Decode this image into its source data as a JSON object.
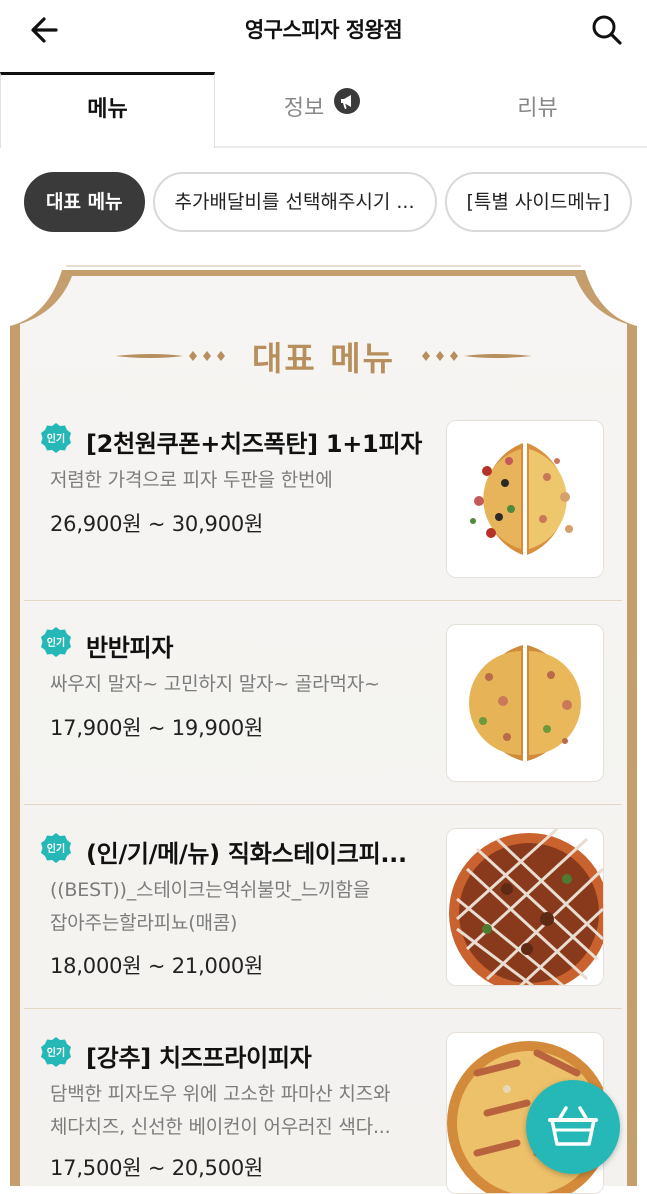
{
  "header": {
    "title": "영구스피자 정왕점"
  },
  "tabs": [
    {
      "label": "메뉴",
      "active": true
    },
    {
      "label": "정보",
      "active": false
    },
    {
      "label": "리뷰",
      "active": false
    }
  ],
  "chips": [
    {
      "label": "대표 메뉴",
      "active": true
    },
    {
      "label": "추가배달비를 선택해주시기 ...",
      "active": false
    },
    {
      "label": "[특별 사이드메뉴]",
      "active": false
    }
  ],
  "section": {
    "title": "대표 메뉴"
  },
  "badge_label": "인기",
  "menu_items": [
    {
      "name": "[2천원쿠폰+치즈폭탄] 1+1피자",
      "desc": "저렴한 가격으로 피자 두판을 한번에",
      "price": "26,900원 ~ 30,900원"
    },
    {
      "name": "반반피자",
      "desc": "싸우지 말자~ 고민하지 말자~ 골라먹자~",
      "price": "17,900원 ~ 19,900원"
    },
    {
      "name": "(인/기/메/뉴) 직화스테이크피...",
      "desc_line1": "((BEST))_스테이크는역쉬불맛_느끼함을",
      "desc_line2": "잡아주는할라피뇨(매콤)",
      "price": "18,000원 ~ 21,000원"
    },
    {
      "name": "[강추] 치즈프라이피자",
      "desc_line1": "담백한 피자도우 위에 고소한 파마산 치즈와",
      "desc_line2": "체다치즈, 신선한 베이컨이 어우러진 색다...",
      "price": "17,500원 ~ 20,500원"
    }
  ],
  "colors": {
    "accent_teal": "#26b8b6",
    "frame_brown": "#b78f5c",
    "chip_active": "#3a3a3a"
  }
}
